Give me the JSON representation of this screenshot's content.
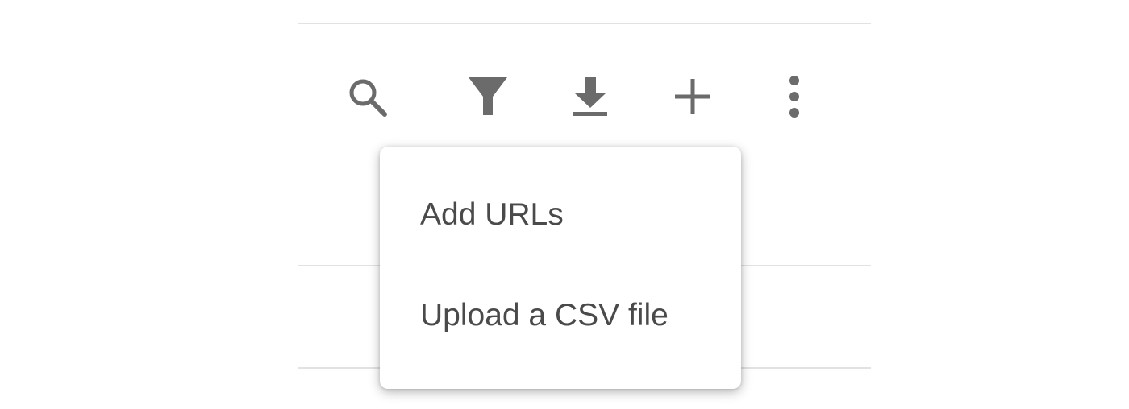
{
  "toolbar": {
    "icons": [
      {
        "name": "search-icon"
      },
      {
        "name": "filter-icon"
      },
      {
        "name": "download-icon"
      },
      {
        "name": "add-icon"
      },
      {
        "name": "more-vert-icon"
      }
    ],
    "icon_color": "#6b6b6b"
  },
  "add_menu": {
    "items": [
      {
        "label": "Add URLs"
      },
      {
        "label": "Upload a CSV file"
      }
    ],
    "text_color": "#4a4a4a"
  }
}
